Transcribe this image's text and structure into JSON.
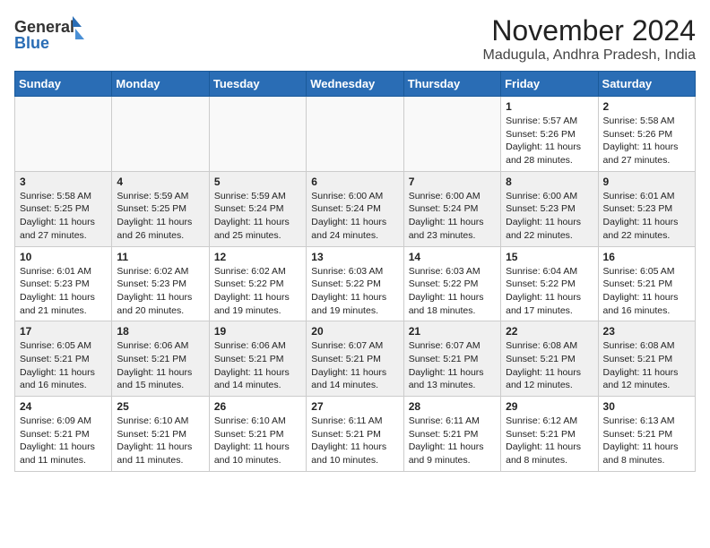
{
  "header": {
    "logo_general": "General",
    "logo_blue": "Blue",
    "month_title": "November 2024",
    "location": "Madugula, Andhra Pradesh, India"
  },
  "weekdays": [
    "Sunday",
    "Monday",
    "Tuesday",
    "Wednesday",
    "Thursday",
    "Friday",
    "Saturday"
  ],
  "weeks": [
    [
      {
        "day": "",
        "info": ""
      },
      {
        "day": "",
        "info": ""
      },
      {
        "day": "",
        "info": ""
      },
      {
        "day": "",
        "info": ""
      },
      {
        "day": "",
        "info": ""
      },
      {
        "day": "1",
        "info": "Sunrise: 5:57 AM\nSunset: 5:26 PM\nDaylight: 11 hours and 28 minutes."
      },
      {
        "day": "2",
        "info": "Sunrise: 5:58 AM\nSunset: 5:26 PM\nDaylight: 11 hours and 27 minutes."
      }
    ],
    [
      {
        "day": "3",
        "info": "Sunrise: 5:58 AM\nSunset: 5:25 PM\nDaylight: 11 hours and 27 minutes."
      },
      {
        "day": "4",
        "info": "Sunrise: 5:59 AM\nSunset: 5:25 PM\nDaylight: 11 hours and 26 minutes."
      },
      {
        "day": "5",
        "info": "Sunrise: 5:59 AM\nSunset: 5:24 PM\nDaylight: 11 hours and 25 minutes."
      },
      {
        "day": "6",
        "info": "Sunrise: 6:00 AM\nSunset: 5:24 PM\nDaylight: 11 hours and 24 minutes."
      },
      {
        "day": "7",
        "info": "Sunrise: 6:00 AM\nSunset: 5:24 PM\nDaylight: 11 hours and 23 minutes."
      },
      {
        "day": "8",
        "info": "Sunrise: 6:00 AM\nSunset: 5:23 PM\nDaylight: 11 hours and 22 minutes."
      },
      {
        "day": "9",
        "info": "Sunrise: 6:01 AM\nSunset: 5:23 PM\nDaylight: 11 hours and 22 minutes."
      }
    ],
    [
      {
        "day": "10",
        "info": "Sunrise: 6:01 AM\nSunset: 5:23 PM\nDaylight: 11 hours and 21 minutes."
      },
      {
        "day": "11",
        "info": "Sunrise: 6:02 AM\nSunset: 5:23 PM\nDaylight: 11 hours and 20 minutes."
      },
      {
        "day": "12",
        "info": "Sunrise: 6:02 AM\nSunset: 5:22 PM\nDaylight: 11 hours and 19 minutes."
      },
      {
        "day": "13",
        "info": "Sunrise: 6:03 AM\nSunset: 5:22 PM\nDaylight: 11 hours and 19 minutes."
      },
      {
        "day": "14",
        "info": "Sunrise: 6:03 AM\nSunset: 5:22 PM\nDaylight: 11 hours and 18 minutes."
      },
      {
        "day": "15",
        "info": "Sunrise: 6:04 AM\nSunset: 5:22 PM\nDaylight: 11 hours and 17 minutes."
      },
      {
        "day": "16",
        "info": "Sunrise: 6:05 AM\nSunset: 5:21 PM\nDaylight: 11 hours and 16 minutes."
      }
    ],
    [
      {
        "day": "17",
        "info": "Sunrise: 6:05 AM\nSunset: 5:21 PM\nDaylight: 11 hours and 16 minutes."
      },
      {
        "day": "18",
        "info": "Sunrise: 6:06 AM\nSunset: 5:21 PM\nDaylight: 11 hours and 15 minutes."
      },
      {
        "day": "19",
        "info": "Sunrise: 6:06 AM\nSunset: 5:21 PM\nDaylight: 11 hours and 14 minutes."
      },
      {
        "day": "20",
        "info": "Sunrise: 6:07 AM\nSunset: 5:21 PM\nDaylight: 11 hours and 14 minutes."
      },
      {
        "day": "21",
        "info": "Sunrise: 6:07 AM\nSunset: 5:21 PM\nDaylight: 11 hours and 13 minutes."
      },
      {
        "day": "22",
        "info": "Sunrise: 6:08 AM\nSunset: 5:21 PM\nDaylight: 11 hours and 12 minutes."
      },
      {
        "day": "23",
        "info": "Sunrise: 6:08 AM\nSunset: 5:21 PM\nDaylight: 11 hours and 12 minutes."
      }
    ],
    [
      {
        "day": "24",
        "info": "Sunrise: 6:09 AM\nSunset: 5:21 PM\nDaylight: 11 hours and 11 minutes."
      },
      {
        "day": "25",
        "info": "Sunrise: 6:10 AM\nSunset: 5:21 PM\nDaylight: 11 hours and 11 minutes."
      },
      {
        "day": "26",
        "info": "Sunrise: 6:10 AM\nSunset: 5:21 PM\nDaylight: 11 hours and 10 minutes."
      },
      {
        "day": "27",
        "info": "Sunrise: 6:11 AM\nSunset: 5:21 PM\nDaylight: 11 hours and 10 minutes."
      },
      {
        "day": "28",
        "info": "Sunrise: 6:11 AM\nSunset: 5:21 PM\nDaylight: 11 hours and 9 minutes."
      },
      {
        "day": "29",
        "info": "Sunrise: 6:12 AM\nSunset: 5:21 PM\nDaylight: 11 hours and 8 minutes."
      },
      {
        "day": "30",
        "info": "Sunrise: 6:13 AM\nSunset: 5:21 PM\nDaylight: 11 hours and 8 minutes."
      }
    ]
  ]
}
